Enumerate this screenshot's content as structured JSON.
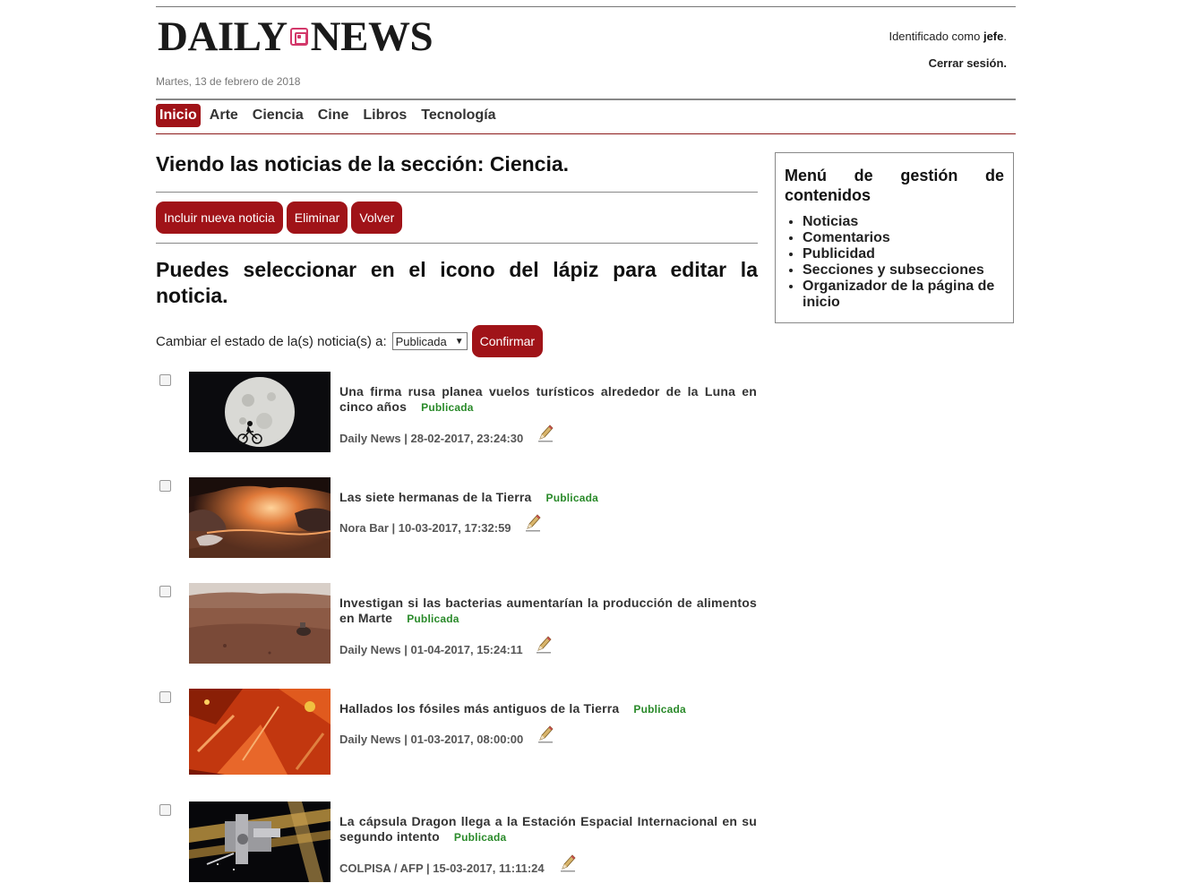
{
  "header": {
    "logo_left": "DAILY",
    "logo_right": "NEWS",
    "date": "Martes, 13 de febrero de 2018",
    "user_prefix": "Identificado como ",
    "user_name": "jefe",
    "user_suffix": ".",
    "logout_label": "Cerrar sesión."
  },
  "nav": {
    "items": [
      "Inicio",
      "Arte",
      "Ciencia",
      "Cine",
      "Libros",
      "Tecnología"
    ],
    "active": "Inicio"
  },
  "main": {
    "section_title": "Viendo las noticias de la sección: Ciencia.",
    "buttons": {
      "add": "Incluir nueva noticia",
      "delete": "Eliminar",
      "back": "Volver"
    },
    "instructions": "Puedes seleccionar en el icono del lápiz para editar la noticia.",
    "status_label": "Cambiar el estado de la(s) noticia(s) a:",
    "status_selected": "Publicada",
    "confirm_label": "Confirmar"
  },
  "news": [
    {
      "title": "Una firma rusa planea vuelos turísticos alrededor de la Luna en cinco años",
      "state": "Publicada",
      "meta": "Daily News | 28-02-2017, 23:24:30",
      "thumb_icon": "moon-bicycle-image"
    },
    {
      "title": "Las siete hermanas de la Tierra",
      "state": "Publicada",
      "meta": "Nora Bar | 10-03-2017, 17:32:59",
      "thumb_icon": "exoplanet-landscape-image"
    },
    {
      "title": "Investigan si las bacterias aumentarían la producción de alimentos en Marte",
      "state": "Publicada",
      "meta": "Daily News | 01-04-2017, 15:24:11",
      "thumb_icon": "mars-surface-image"
    },
    {
      "title": "Hallados los fósiles más antiguos de la Tierra",
      "state": "Publicada",
      "meta": "Daily News | 01-03-2017, 08:00:00",
      "thumb_icon": "fossil-microscope-image"
    },
    {
      "title": "La cápsula Dragon llega a la Estación Espacial Internacional en su segundo intento",
      "state": "Publicada",
      "meta": "COLPISA / AFP | 15-03-2017, 11:11:24",
      "thumb_icon": "space-station-image"
    }
  ],
  "sidebar": {
    "title": "Menú de gestión de contenidos",
    "items": [
      "Noticias",
      "Comentarios",
      "Publicidad",
      "Secciones y subsecciones",
      "Organizador de la página de inicio"
    ]
  },
  "colors": {
    "accent": "#a01318",
    "published": "#2a8a2a",
    "logo_mark": "#d3386a"
  }
}
